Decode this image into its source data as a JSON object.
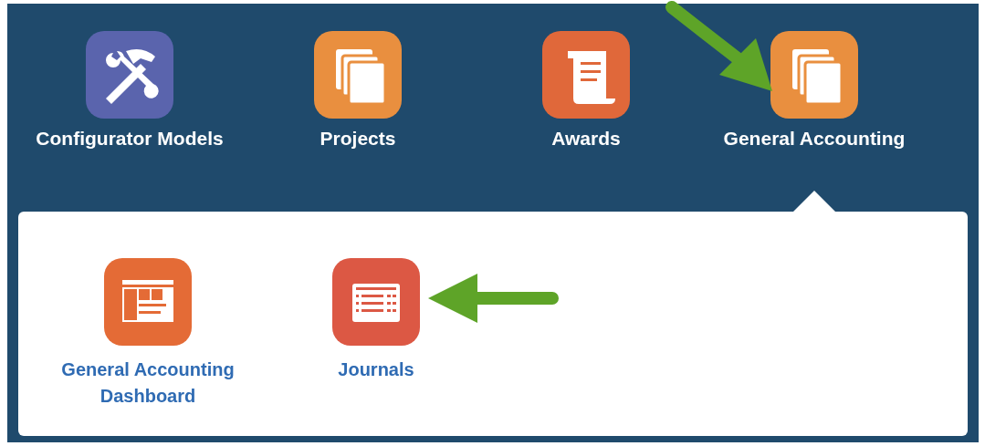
{
  "apps": [
    {
      "label": "Configurator Models",
      "kind": "tools",
      "color": "#5a64ad",
      "selected": false
    },
    {
      "label": "Projects",
      "kind": "stack",
      "color": "#e98f3f",
      "selected": false
    },
    {
      "label": "Awards",
      "kind": "scroll",
      "color": "#e0683a",
      "selected": false
    },
    {
      "label": "General Accounting",
      "kind": "stack",
      "color": "#e98f3f",
      "selected": true
    }
  ],
  "submenu": [
    {
      "label": "General Accounting Dashboard",
      "kind": "dashboard",
      "color": "#e46b36"
    },
    {
      "label": "Journals",
      "kind": "table",
      "color": "#dc5844"
    }
  ]
}
